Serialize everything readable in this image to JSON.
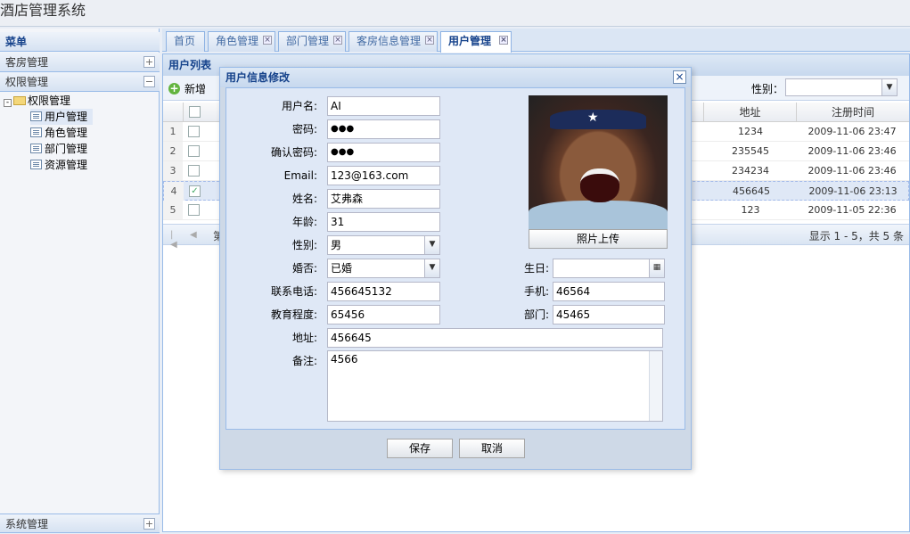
{
  "app": {
    "title": "酒店管理系统"
  },
  "sidebar": {
    "menu_title": "菜单",
    "sections": [
      {
        "label": "客房管理",
        "toggle": "+"
      },
      {
        "label": "权限管理",
        "toggle": "−"
      },
      {
        "label": "系统管理",
        "toggle": "+"
      }
    ],
    "tree": {
      "root": "权限管理",
      "items": [
        "用户管理",
        "角色管理",
        "部门管理",
        "资源管理"
      ]
    }
  },
  "tabs": [
    {
      "label": "首页"
    },
    {
      "label": "角色管理"
    },
    {
      "label": "部门管理"
    },
    {
      "label": "客房信息管理"
    },
    {
      "label": "用户管理"
    }
  ],
  "tab_close_glyph": "×",
  "user_list": {
    "title": "用户列表",
    "add_label": "新增",
    "gender_label": "性别：",
    "gender_value": "",
    "columns": {
      "address": "地址",
      "register_time": "注册时间"
    },
    "rows": [
      {
        "num": "1",
        "checked": "",
        "address": "1234",
        "time": "2009-11-06 23:47"
      },
      {
        "num": "2",
        "checked": "",
        "address": "235545",
        "time": "2009-11-06 23:46"
      },
      {
        "num": "3",
        "checked": "",
        "address": "234234",
        "time": "2009-11-06 23:46"
      },
      {
        "num": "4",
        "checked": "✓",
        "address": "456645",
        "time": "2009-11-06 23:13"
      },
      {
        "num": "5",
        "checked": "",
        "address": "123",
        "time": "2009-11-05 22:36"
      }
    ],
    "paging_text": "第",
    "paging_info": "显示 1 - 5，共 5 条"
  },
  "dialog": {
    "title": "用户信息修改",
    "close": "×",
    "labels": {
      "username": "用户名:",
      "password": "密码:",
      "confirm": "确认密码:",
      "email": "Email:",
      "name": "姓名:",
      "age": "年龄:",
      "gender": "性别:",
      "married": "婚否:",
      "phone": "联系电话:",
      "education": "教育程度:",
      "address": "地址:",
      "notes": "备注:",
      "birthday": "生日:",
      "mobile": "手机:",
      "department": "部门:"
    },
    "values": {
      "username": "AI",
      "password": "●●●",
      "confirm": "●●●",
      "email": "123@163.com",
      "name": "艾弗森",
      "age": "31",
      "gender": "男",
      "married": "已婚",
      "phone": "456645132",
      "education": "65456",
      "address": "456645",
      "notes": "4566",
      "birthday": "",
      "mobile": "46564",
      "department": "45465"
    },
    "photo_upload": "照片上传",
    "save": "保存",
    "cancel": "取消"
  }
}
